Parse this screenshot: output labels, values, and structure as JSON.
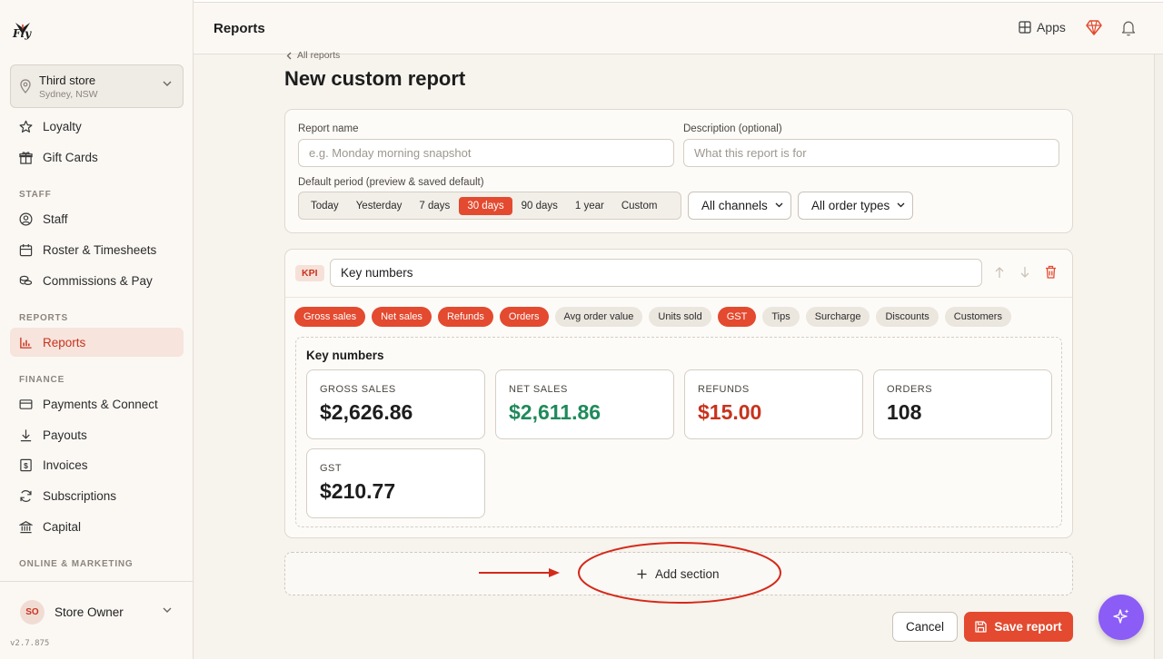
{
  "app": {
    "logo_text": "Fly",
    "version": "v2.7.875"
  },
  "store": {
    "name": "Third store",
    "location": "Sydney, NSW"
  },
  "sidebar": {
    "items_top": [
      {
        "label": "Loyalty",
        "icon": "star-icon"
      },
      {
        "label": "Gift Cards",
        "icon": "gift-icon"
      }
    ],
    "staff_heading": "STAFF",
    "staff_items": [
      {
        "label": "Staff",
        "icon": "user-circle-icon"
      },
      {
        "label": "Roster & Timesheets",
        "icon": "calendar-icon"
      },
      {
        "label": "Commissions & Pay",
        "icon": "coins-icon"
      }
    ],
    "reports_heading": "REPORTS",
    "reports_item": {
      "label": "Reports",
      "icon": "bar-chart-icon"
    },
    "finance_heading": "FINANCE",
    "finance_items": [
      {
        "label": "Payments & Connect",
        "icon": "credit-card-icon"
      },
      {
        "label": "Payouts",
        "icon": "download-icon"
      },
      {
        "label": "Invoices",
        "icon": "invoice-icon"
      },
      {
        "label": "Subscriptions",
        "icon": "refresh-icon"
      },
      {
        "label": "Capital",
        "icon": "bank-icon"
      }
    ],
    "marketing_heading": "ONLINE & MARKETING"
  },
  "user": {
    "initials": "SO",
    "name": "Store Owner"
  },
  "header": {
    "title": "Reports",
    "apps_label": "Apps"
  },
  "page": {
    "breadcrumb": "All reports",
    "title": "New custom report"
  },
  "form": {
    "report_name_label": "Report name",
    "report_name_placeholder": "e.g. Monday morning snapshot",
    "description_label": "Description (optional)",
    "description_placeholder": "What this report is for",
    "period_label": "Default period (preview & saved default)",
    "periods": [
      "Today",
      "Yesterday",
      "7 days",
      "30 days",
      "90 days",
      "1 year",
      "Custom"
    ],
    "selected_period": "30 days",
    "channel": "All channels",
    "order_type": "All order types"
  },
  "section": {
    "type_tag": "KPI",
    "name": "Key numbers",
    "metrics": [
      {
        "label": "Gross sales",
        "selected": true
      },
      {
        "label": "Net sales",
        "selected": true
      },
      {
        "label": "Refunds",
        "selected": true
      },
      {
        "label": "Orders",
        "selected": true
      },
      {
        "label": "Avg order value",
        "selected": false
      },
      {
        "label": "Units sold",
        "selected": false
      },
      {
        "label": "GST",
        "selected": true
      },
      {
        "label": "Tips",
        "selected": false
      },
      {
        "label": "Surcharge",
        "selected": false
      },
      {
        "label": "Discounts",
        "selected": false
      },
      {
        "label": "Customers",
        "selected": false
      }
    ],
    "preview_title": "Key numbers",
    "kpis": [
      {
        "label": "GROSS SALES",
        "value": "$2,626.86",
        "color": "#1d1d1d"
      },
      {
        "label": "NET SALES",
        "value": "$2,611.86",
        "color": "#1f8a5b"
      },
      {
        "label": "REFUNDS",
        "value": "$15.00",
        "color": "#c8331d"
      },
      {
        "label": "ORDERS",
        "value": "108",
        "color": "#1d1d1d"
      },
      {
        "label": "GST",
        "value": "$210.77",
        "color": "#1d1d1d"
      }
    ]
  },
  "actions": {
    "add_section": "Add section",
    "cancel": "Cancel",
    "save": "Save report"
  },
  "colors": {
    "accent": "#e34a2f",
    "ai_button": "#8b5cf6"
  }
}
